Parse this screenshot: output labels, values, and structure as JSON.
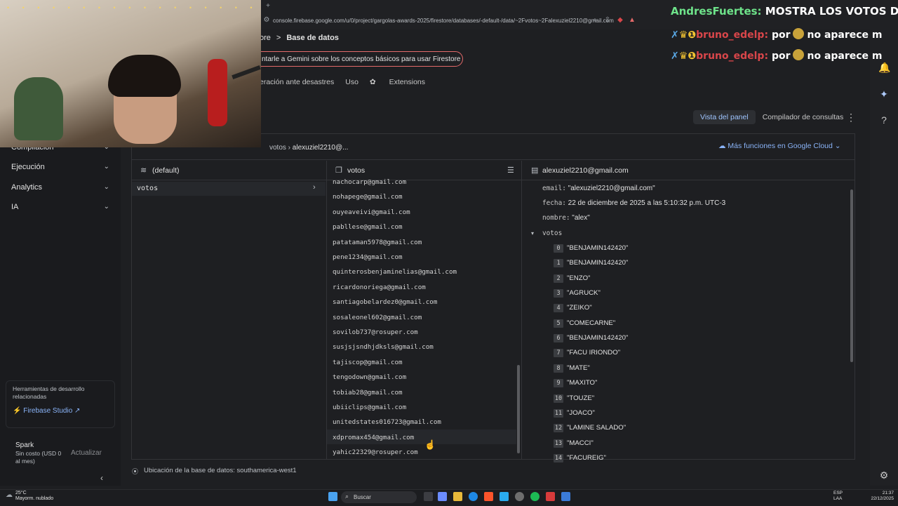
{
  "browser": {
    "url": "console.firebase.google.com/u/0/project/gargolas-awards-2025/firestore/databases/-default-/data/~2Fvotos~2Falexuziel2210@gmail.com"
  },
  "header": {
    "breadcrumb": [
      "ore",
      ">",
      "Base de datos"
    ],
    "gemini_prompt": "ntarle a Gemini sobre los conceptos básicos para usar Firestore",
    "tabs": [
      "eración ante desastres",
      "Uso",
      "Extensions"
    ],
    "view_toggle": [
      "Vista del panel",
      "Compilador de consultas"
    ]
  },
  "sidenav": {
    "items": [
      "Compilación",
      "Ejecución",
      "Analytics",
      "IA"
    ],
    "tools_title": "Herramientas de desarrollo relacionadas",
    "firebase_studio": "Firebase Studio",
    "plan_name": "Spark",
    "plan_sub": "Sin costo (USD 0 al mes)",
    "update": "Actualizar"
  },
  "panel": {
    "path": [
      "votos",
      "alexuziel2210@..."
    ],
    "cloud_link": "Más funciones en Google Cloud",
    "col1_title": "(default)",
    "col1_items": [
      "votos"
    ],
    "col2_title": "votos",
    "col2_items": [
      "nachocarp@gmail.com",
      "nohapege@gmail.com",
      "ouyeaveivi@gmail.com",
      "pabllese@gmail.com",
      "patataman5978@gmail.com",
      "pene1234@gmail.com",
      "quinterosbenjaminelias@gmail.com",
      "ricardonoriega@gmail.com",
      "santiagobelardez0@gmail.com",
      "sosaleonel602@gmail.com",
      "sovilob737@rosuper.com",
      "susjsjsndhjdksls@gmail.com",
      "tajiscop@gmail.com",
      "tengodown@gmail.com",
      "tobiab28@gmail.com",
      "ubiiclips@gmail.com",
      "unitedstates016723@gmail.com",
      "xdpromax454@gmail.com",
      "yahic22329@rosuper.com"
    ],
    "col3_title": "alexuziel2210@gmail.com",
    "fields": [
      {
        "key": "email:",
        "value": "\"alexuziel2210@gmail.com\""
      },
      {
        "key": "fecha:",
        "value": "22 de diciembre de 2025 a las 5:10:32 p.m. UTC-3"
      },
      {
        "key": "nombre:",
        "value": "\"alex\""
      },
      {
        "key": "votos",
        "value": ""
      }
    ],
    "votos": [
      {
        "i": "0",
        "v": "\"BENJAMIN142420\""
      },
      {
        "i": "1",
        "v": "\"BENJAMIN142420\""
      },
      {
        "i": "2",
        "v": "\"ENZO\""
      },
      {
        "i": "3",
        "v": "\"AGRUCK\""
      },
      {
        "i": "4",
        "v": "\"ZEIKO\""
      },
      {
        "i": "5",
        "v": "\"COMECARNE\""
      },
      {
        "i": "6",
        "v": "\"BENJAMIN142420\""
      },
      {
        "i": "7",
        "v": "\"FACU IRIONDO\""
      },
      {
        "i": "8",
        "v": "\"MATE\""
      },
      {
        "i": "9",
        "v": "\"MAXITO\""
      },
      {
        "i": "10",
        "v": "\"TOUZE\""
      },
      {
        "i": "11",
        "v": "\"JOACO\""
      },
      {
        "i": "12",
        "v": "\"LAMINE SALADO\""
      },
      {
        "i": "13",
        "v": "\"MACCI\""
      },
      {
        "i": "14",
        "v": "\"FACUREIG\""
      }
    ],
    "location": "Ubicación de la base de datos: southamerica-west1"
  },
  "chat": {
    "line1_user": "AndresFuertes:",
    "line1_text": "MOSTRA LOS VOTOS DEL",
    "line2_user": "bruno_edelp:",
    "line2_text": "por",
    "line2_tail": "no aparece m",
    "line3_user": "bruno_edelp:",
    "line3_text": "por",
    "line3_tail": "no aparece m"
  },
  "taskbar": {
    "weather_temp": "25°C",
    "weather_desc": "Mayorm. nublado",
    "search": "Buscar",
    "lang1": "ESP",
    "lang2": "LAA",
    "time": "21:37",
    "date": "22/12/2025"
  },
  "colors": {
    "accent": "#8ab4f8",
    "gemini_border": "#e46a6a",
    "chat_user_green": "#6ee38a",
    "chat_user_red": "#d9464a"
  }
}
